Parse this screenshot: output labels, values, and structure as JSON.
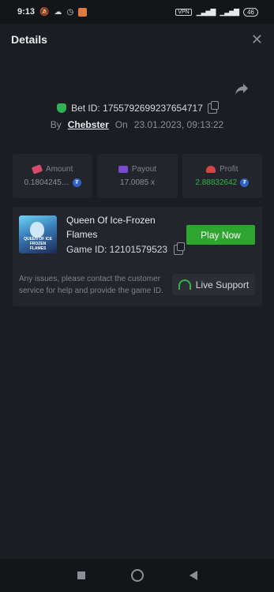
{
  "status_bar": {
    "time": "9:13",
    "vpn": "VPN",
    "battery": "46"
  },
  "header": {
    "title": "Details",
    "close_icon": "close-icon"
  },
  "bet": {
    "bet_id_label": "Bet ID: 1755792699237654717",
    "by_label": "By",
    "user": "Chebster",
    "on_label": "On",
    "datetime": "23.01.2023, 09:13:22"
  },
  "stats": {
    "amount": {
      "label": "Amount",
      "value": "0.1804245…"
    },
    "payout": {
      "label": "Payout",
      "value": "17.0085 x"
    },
    "profit": {
      "label": "Profit",
      "value": "2.88832642"
    }
  },
  "game": {
    "title": "Queen Of Ice-Frozen Flames",
    "game_id": "Game ID: 12101579523",
    "thumbnail_caption": "QUEEN OF ICE FROZEN FLAMES",
    "play_button": "Play Now",
    "issues_text": "Any issues, please contact the customer service for help and provide the game ID.",
    "support_button": "Live Support"
  },
  "colors": {
    "accent_green": "#2ea52f",
    "profit_green": "#37b24d",
    "background": "#1b1d22",
    "card": "#22252b"
  }
}
